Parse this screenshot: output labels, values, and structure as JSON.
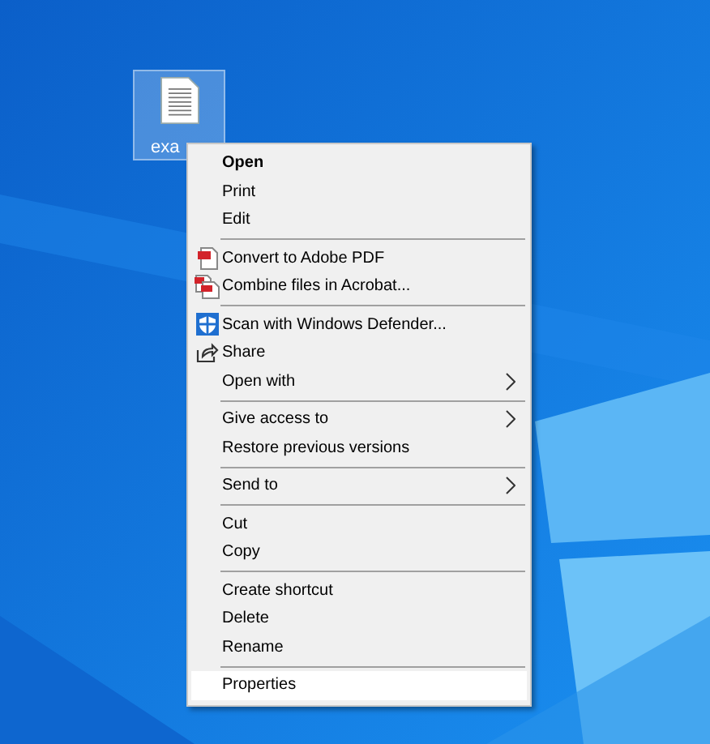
{
  "desktop_icon": {
    "label": "exa",
    "selected": true
  },
  "context_menu": {
    "sections": [
      {
        "items": [
          {
            "label": "Open",
            "kind": "plain",
            "default": true,
            "submenu": false,
            "selected": false
          },
          {
            "label": "Print",
            "kind": "plain",
            "default": false,
            "submenu": false,
            "selected": false
          },
          {
            "label": "Edit",
            "kind": "plain",
            "default": false,
            "submenu": false,
            "selected": false
          }
        ]
      },
      {
        "items": [
          {
            "label": "Convert to Adobe PDF",
            "kind": "acrobat",
            "default": false,
            "submenu": false,
            "selected": false
          },
          {
            "label": "Combine files in Acrobat...",
            "kind": "acrobat-combine",
            "default": false,
            "submenu": false,
            "selected": false
          }
        ]
      },
      {
        "items": [
          {
            "label": "Scan with Windows Defender...",
            "kind": "shield",
            "default": false,
            "submenu": false,
            "selected": false
          },
          {
            "label": "Share",
            "kind": "share",
            "default": false,
            "submenu": false,
            "selected": false
          },
          {
            "label": "Open with",
            "kind": "plain",
            "default": false,
            "submenu": true,
            "selected": false
          }
        ]
      },
      {
        "items": [
          {
            "label": "Give access to",
            "kind": "plain",
            "default": false,
            "submenu": true,
            "selected": false
          },
          {
            "label": "Restore previous versions",
            "kind": "plain",
            "default": false,
            "submenu": false,
            "selected": false
          }
        ]
      },
      {
        "items": [
          {
            "label": "Send to",
            "kind": "plain",
            "default": false,
            "submenu": true,
            "selected": false
          }
        ]
      },
      {
        "items": [
          {
            "label": "Cut",
            "kind": "plain",
            "default": false,
            "submenu": false,
            "selected": false
          },
          {
            "label": "Copy",
            "kind": "plain",
            "default": false,
            "submenu": false,
            "selected": false
          }
        ]
      },
      {
        "items": [
          {
            "label": "Create shortcut",
            "kind": "plain",
            "default": false,
            "submenu": false,
            "selected": false
          },
          {
            "label": "Delete",
            "kind": "plain",
            "default": false,
            "submenu": false,
            "selected": false
          },
          {
            "label": "Rename",
            "kind": "plain",
            "default": false,
            "submenu": false,
            "selected": false
          }
        ]
      },
      {
        "items": [
          {
            "label": "Properties",
            "kind": "plain",
            "default": false,
            "submenu": false,
            "selected": true,
            "annotated": true
          }
        ]
      }
    ]
  }
}
